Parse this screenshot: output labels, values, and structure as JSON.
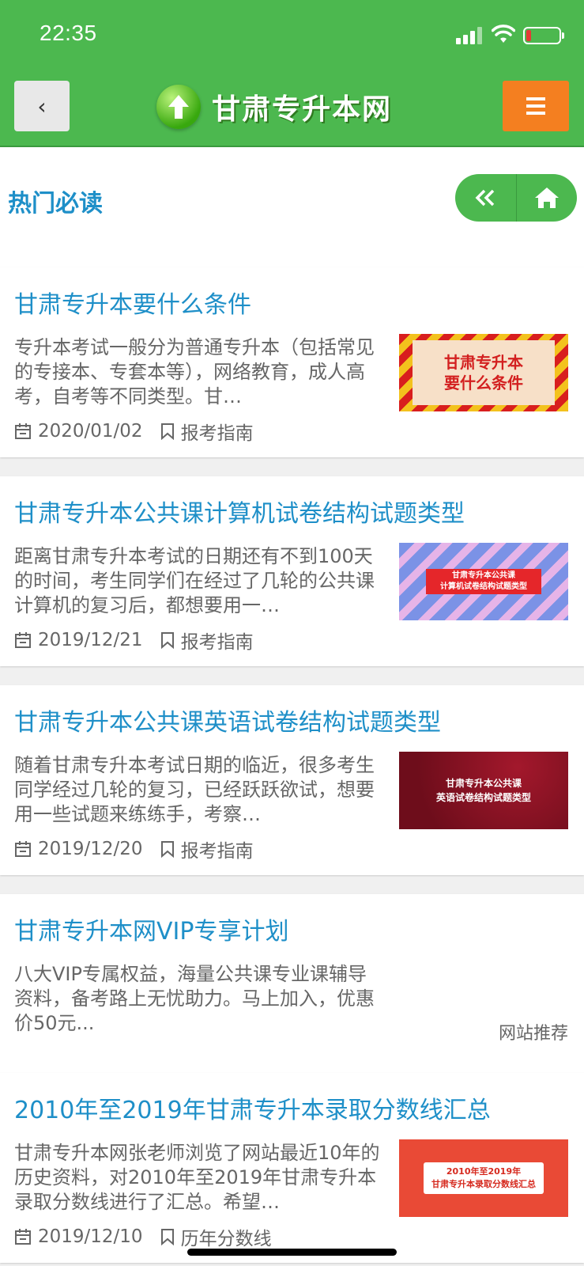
{
  "status": {
    "time": "22:35"
  },
  "header": {
    "site_name": "甘肃专升本网",
    "back_label": "‹"
  },
  "section": {
    "title": "热门必读"
  },
  "articles": [
    {
      "title": "甘肃专升本要什么条件",
      "desc": "专升本考试一般分为普通专升本（包括常见的专接本、专套本等），网络教育，成人高考，自考等不同类型。甘…",
      "date": "2020/01/02",
      "category": "报考指南",
      "thumb_text": "甘肃专升本\n要什么条件"
    },
    {
      "title": "甘肃专升本公共课计算机试卷结构试题类型",
      "desc": "距离甘肃专升本考试的日期还有不到100天的时间，考生同学们在经过了几轮的公共课计算机的复习后，都想要用一…",
      "date": "2019/12/21",
      "category": "报考指南",
      "thumb_text": "甘肃专升本公共课\n计算机试卷结构试题类型"
    },
    {
      "title": "甘肃专升本公共课英语试卷结构试题类型",
      "desc": "随着甘肃专升本考试日期的临近，很多考生同学经过几轮的复习，已经跃跃欲试，想要用一些试题来练练手，考察…",
      "date": "2019/12/20",
      "category": "报考指南",
      "thumb_text": "甘肃专升本公共课\n英语试卷结构试题类型"
    },
    {
      "title": "甘肃专升本网VIP专享计划",
      "desc": "八大VIP专属权益，海量公共课专业课辅导资料，备考路上无忧助力。马上加入，优惠价50元...",
      "tag": "网站推荐"
    },
    {
      "title": "2010年至2019年甘肃专升本录取分数线汇总",
      "desc": "甘肃专升本网张老师浏览了网站最近10年的历史资料，对2010年至2019年甘肃专升本录取分数线进行了汇总。希望…",
      "date": "2019/12/10",
      "category": "历年分数线",
      "thumb_text": "2010年至2019年\n甘肃专升本录取分数线汇总"
    }
  ]
}
